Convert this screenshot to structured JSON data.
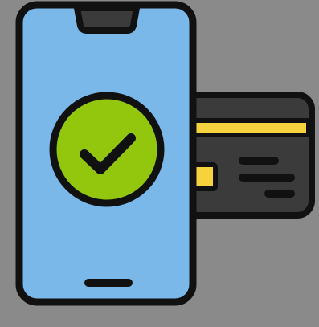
{
  "illustration": {
    "subject": "mobile-payment-success-icon",
    "colors": {
      "background": "#8a8a8a",
      "outline": "#111111",
      "phone_screen": "#7ab8ea",
      "phone_notch": "#3b3b3b",
      "check_circle": "#92c70e",
      "card_body": "#3b3b3b",
      "card_stripe": "#f5d23e",
      "card_chip": "#f5d23e",
      "card_lines": "#111111"
    },
    "icons": [
      "smartphone-icon",
      "checkmark-icon",
      "credit-card-icon"
    ]
  }
}
